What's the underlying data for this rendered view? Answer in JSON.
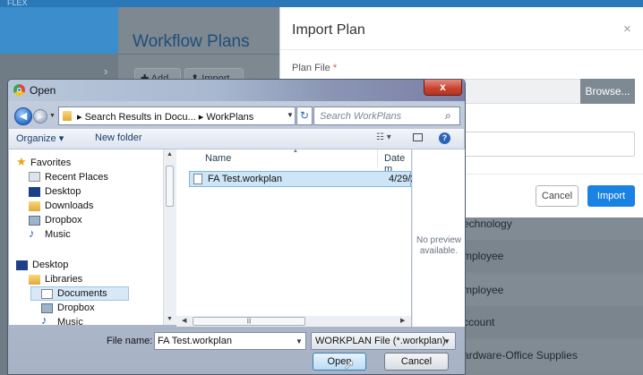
{
  "background": {
    "top_faint_text": "FLEX",
    "page_title": "Workflow Plans",
    "add_label": "Add",
    "import_label": "Import",
    "rows": [
      "echnology",
      "mployee",
      "mployee",
      "ccount",
      "ardware-Office Supplies"
    ]
  },
  "modal": {
    "title": "Import Plan",
    "close": "×",
    "plan_file_label": "Plan File",
    "required_mark": "*",
    "browse": "Browse...",
    "cancel": "Cancel",
    "import": "Import"
  },
  "dialog": {
    "title": "Open",
    "close": "x",
    "address": "▸ Search Results in Docu... ▸ WorkPlans",
    "search_placeholder": "Search WorkPlans",
    "toolbar": {
      "organize": "Organize ▾",
      "new_folder": "New folder"
    },
    "nav": {
      "favorites": "Favorites",
      "recent": "Recent Places",
      "desktop": "Desktop",
      "downloads": "Downloads",
      "dropbox": "Dropbox",
      "music": "Music",
      "desktop2": "Desktop",
      "libraries": "Libraries",
      "documents": "Documents",
      "dropbox2": "Dropbox",
      "music2": "Music"
    },
    "columns": {
      "name": "Name",
      "date": "Date m"
    },
    "file": {
      "name": "FA Test.workplan",
      "date": "4/29/20"
    },
    "preview": "No preview available.",
    "file_name_label": "File name:",
    "file_name_value": "FA Test.workplan",
    "filter": "WORKPLAN File (*.workplan)",
    "open": "Open",
    "cancel": "Cancel"
  },
  "colors": {
    "accent": "#1a82e2",
    "navbar": "#3b8dcc",
    "dialog_close": "#c6412e"
  }
}
